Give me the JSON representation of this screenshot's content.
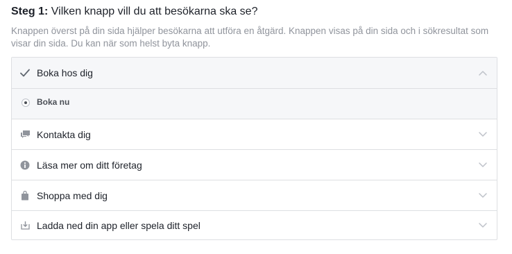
{
  "header": {
    "step_label": "Steg 1:",
    "question": "Vilken knapp vill du att besökarna ska se?"
  },
  "description": "Knappen överst på din sida hjälper besökarna att utföra en åtgärd. Knappen visas på din sida och i sökresultat som visar din sida. Du kan när som helst byta knapp.",
  "options": [
    {
      "label": "Boka hos dig",
      "icon": "checkmark-icon",
      "expanded": true
    },
    {
      "label": "Kontakta dig",
      "icon": "chat-bubbles-icon",
      "expanded": false
    },
    {
      "label": "Läsa mer om ditt företag",
      "icon": "info-icon",
      "expanded": false
    },
    {
      "label": "Shoppa med dig",
      "icon": "shopping-bag-icon",
      "expanded": false
    },
    {
      "label": "Ladda ned din app eller spela ditt spel",
      "icon": "download-icon",
      "expanded": false
    }
  ],
  "suboptions": [
    {
      "label": "Boka nu",
      "selected": true
    }
  ],
  "colors": {
    "border": "#dddfe2",
    "muted_text": "#90949c",
    "icon_gray": "#90949c",
    "open_bg": "#f6f7f9"
  }
}
